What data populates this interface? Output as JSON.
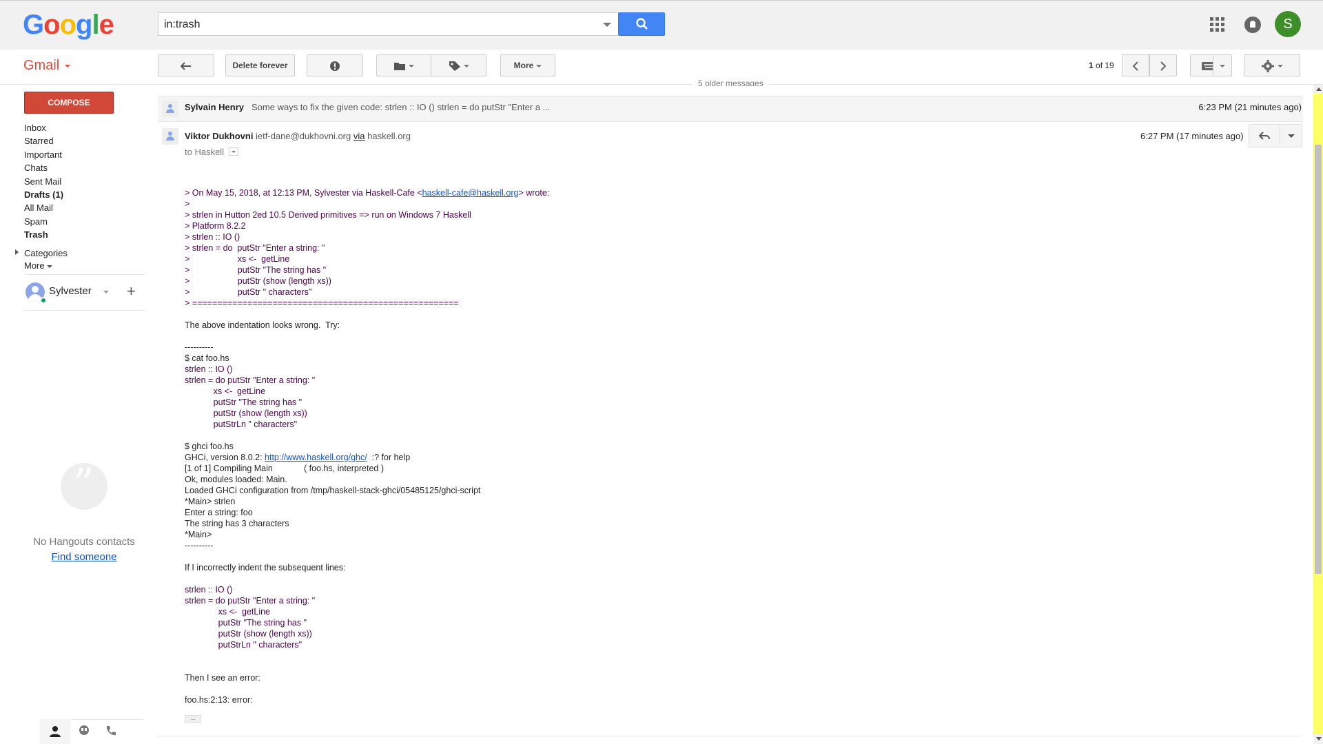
{
  "header": {
    "logo_letters": [
      "G",
      "o",
      "o",
      "g",
      "l",
      "e"
    ],
    "logo_colors": [
      "#4285f4",
      "#ea4335",
      "#fbbc05",
      "#4285f4",
      "#34a853",
      "#ea4335"
    ],
    "search_value": "in:trash",
    "avatar_letter": "S"
  },
  "toolbar": {
    "gmail_label": "Gmail",
    "delete_forever": "Delete forever",
    "more": "More",
    "page_current": "1",
    "page_of": "of 19"
  },
  "sidebar": {
    "compose": "COMPOSE",
    "items": [
      {
        "label": "Inbox",
        "bold": false
      },
      {
        "label": "Starred",
        "bold": false
      },
      {
        "label": "Important",
        "bold": false
      },
      {
        "label": "Chats",
        "bold": false
      },
      {
        "label": "Sent Mail",
        "bold": false
      },
      {
        "label": "Drafts (1)",
        "bold": true
      },
      {
        "label": "All Mail",
        "bold": false
      },
      {
        "label": "Spam",
        "bold": false
      },
      {
        "label": "Trash",
        "bold": true
      }
    ],
    "categories": "Categories",
    "more": "More",
    "user_name": "Sylvester",
    "no_hangouts": "No Hangouts contacts",
    "find_someone": "Find someone"
  },
  "conversation": {
    "older_messages": "5 older messages",
    "msg1": {
      "sender": "Sylvain Henry",
      "snippet": "Some ways to fix the given code: strlen :: IO () strlen = do putStr \"Enter a ...",
      "time": "6:23 PM (21 minutes ago)"
    },
    "msg2": {
      "sender": "Viktor Dukhovni",
      "email": "ietf-dane@dukhovni.org",
      "via": "via",
      "via_domain": "haskell.org",
      "time": "6:27 PM (17 minutes ago)",
      "to": "to Haskell",
      "quote_intro_pre": "> On May 15, 2018, at 12:13 PM, Sylvester via Haskell-Cafe <",
      "quote_intro_link": "haskell-cafe@haskell.org",
      "quote_intro_post": "> wrote:",
      "quote_lines": [
        ">",
        "> strlen in Hutton 2ed 10.5 Derived primitives => run on Windows 7 Haskell",
        "> Platform 8.2.2",
        "> strlen :: IO ()",
        "> strlen = do  putStr \"Enter a string: \"",
        ">                    xs <-  getLine",
        ">                    putStr \"The string has \"",
        ">                    putStr (show (length xs))",
        ">                    putStr \" characters\"",
        "> ====================================================="
      ],
      "para1": "The above indentation looks wrong.  Try:",
      "code1": [
        "----------",
        "$ cat foo.hs",
        "strlen :: IO ()",
        "strlen = do putStr \"Enter a string: \"",
        "            xs <-  getLine",
        "            putStr \"The string has \"",
        "            putStr (show (length xs))",
        "            putStrLn \" characters\""
      ],
      "ghci_lines_a": [
        "$ ghci foo.hs"
      ],
      "ghci_version_pre": "GHCi, version 8.0.2: ",
      "ghci_version_link": "http://www.haskell.org/ghc/",
      "ghci_version_post": "  :? for help",
      "ghci_lines_b": [
        "[1 of 1] Compiling Main             ( foo.hs, interpreted )",
        "Ok, modules loaded: Main.",
        "Loaded GHCi configuration from /tmp/haskell-stack-ghci/05485125/ghci-script",
        "*Main> strlen",
        "Enter a string: foo",
        "The string has 3 characters",
        "*Main>",
        "----------"
      ],
      "para2": "If I incorrectly indent the subsequent lines:",
      "code2": [
        "strlen :: IO ()",
        "strlen = do putStr \"Enter a string: \"",
        "              xs <-  getLine",
        "              putStr \"The string has \"",
        "              putStr (show (length xs))",
        "              putStrLn \" characters\""
      ],
      "para3": "Then I see an error:",
      "para4": "foo.hs:2:13: error:",
      "ellipsis": "..."
    }
  }
}
